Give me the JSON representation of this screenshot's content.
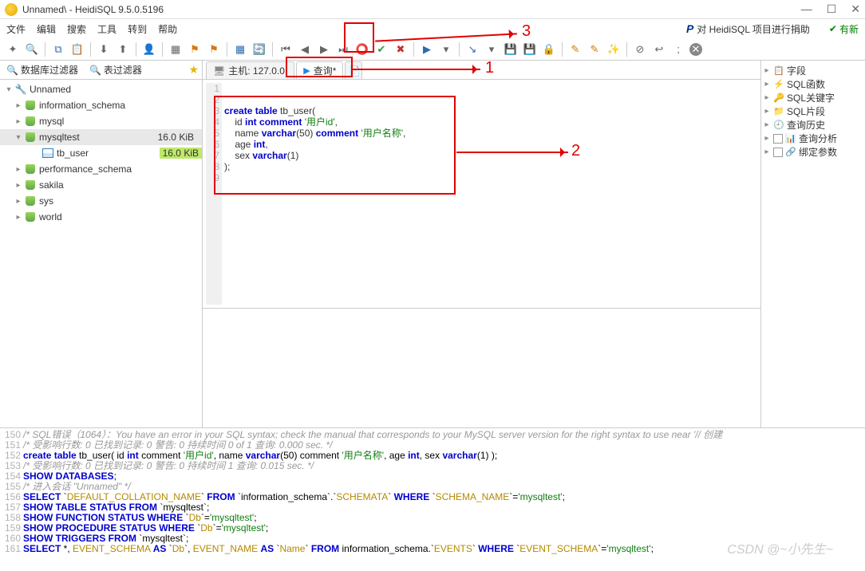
{
  "window": {
    "title": "Unnamed\\ - HeidiSQL 9.5.0.5196"
  },
  "menu": {
    "file": "文件",
    "edit": "编辑",
    "search": "搜索",
    "tools": "工具",
    "goto": "转到",
    "help": "帮助",
    "donate": "对 HeidiSQL 项目进行捐助",
    "update": "有新"
  },
  "filters": {
    "db": "数据库过滤器",
    "table": "表过滤器"
  },
  "tree": {
    "conn": "Unnamed",
    "items": [
      {
        "label": "information_schema"
      },
      {
        "label": "mysql"
      },
      {
        "label": "mysqltest",
        "size": "16.0 KiB",
        "expanded": true,
        "sel": true,
        "children": [
          {
            "label": "tb_user",
            "size": "16.0 KiB",
            "highlight": true
          }
        ]
      },
      {
        "label": "performance_schema"
      },
      {
        "label": "sakila"
      },
      {
        "label": "sys"
      },
      {
        "label": "world"
      }
    ]
  },
  "tabs": {
    "host": "主机: 127.0.0.",
    "query": "查询*"
  },
  "code": {
    "lines": [
      "",
      "",
      "create table tb_user(",
      "    id int comment '用户id',",
      "    name varchar(50) comment '用户名称',",
      "    age int,",
      "    sex varchar(1)",
      ");",
      ""
    ]
  },
  "right": {
    "items": [
      {
        "label": "字段",
        "icon": "📋"
      },
      {
        "label": "SQL函数",
        "icon": "⚡"
      },
      {
        "label": "SQL关键字",
        "icon": "🔑"
      },
      {
        "label": "SQL片段",
        "icon": "📁"
      },
      {
        "label": "查询历史",
        "icon": "🕘"
      },
      {
        "label": "查询分析",
        "icon": "📊",
        "cb": true
      },
      {
        "label": "绑定参数",
        "icon": "🔗",
        "cb": true
      }
    ]
  },
  "log": {
    "lines": [
      {
        "n": "150",
        "html": "<span class='cm'>/* SQL错误（1064）：You have an error in your SQL syntax; check the manual that corresponds to your MySQL server version for the right syntax to use near '// 创建</span>"
      },
      {
        "n": "151",
        "html": "<span class='cm'>/* 受影响行数: 0  已找到记录: 0  警告: 0  持续时间 0 of 1 查询: 0.000 sec. */</span>"
      },
      {
        "n": "152",
        "html": "<span class='kw'>create table</span> tb_user(      id <span class='kw'>int</span> comment <span class='str'>'用户id'</span>,      name <span class='kw'>varchar</span>(50) comment <span class='str'>'用户名称'</span>,      age <span class='kw'>int</span>,      sex <span class='kw'>varchar</span>(1)  );"
      },
      {
        "n": "153",
        "html": "<span class='cm'>/* 受影响行数: 0  已找到记录: 0  警告: 0  持续时间 1 查询: 0.015 sec. */</span>"
      },
      {
        "n": "154",
        "html": "<span class='kw'>SHOW DATABASES</span>;"
      },
      {
        "n": "155",
        "html": "<span class='cm'>/* 进入会话 \"Unnamed\" */</span>"
      },
      {
        "n": "156",
        "html": "<span class='kw'>SELECT</span> `<span class='fn'>DEFAULT_COLLATION_NAME</span>` <span class='kw'>FROM</span> `information_schema`.`<span class='fn'>SCHEMATA</span>` <span class='kw'>WHERE</span> `<span class='fn'>SCHEMA_NAME</span>`=<span class='str'>'mysqltest'</span>;"
      },
      {
        "n": "157",
        "html": "<span class='kw'>SHOW TABLE STATUS FROM</span> `mysqltest`;"
      },
      {
        "n": "158",
        "html": "<span class='kw'>SHOW FUNCTION STATUS WHERE</span> `<span class='fn'>Db</span>`=<span class='str'>'mysqltest'</span>;"
      },
      {
        "n": "159",
        "html": "<span class='kw'>SHOW PROCEDURE STATUS WHERE</span> `<span class='fn'>Db</span>`=<span class='str'>'mysqltest'</span>;"
      },
      {
        "n": "160",
        "html": "<span class='kw'>SHOW TRIGGERS FROM</span> `mysqltest`;"
      },
      {
        "n": "161",
        "html": "<span class='kw'>SELECT</span> *, <span class='fn'>EVENT_SCHEMA</span> <span class='kw'>AS</span> `<span class='fn'>Db</span>`, <span class='fn'>EVENT_NAME</span> <span class='kw'>AS</span> `<span class='fn'>Name</span>` <span class='kw'>FROM</span> information_schema.`<span class='fn'>EVENTS</span>` <span class='kw'>WHERE</span> `<span class='fn'>EVENT_SCHEMA</span>`=<span class='str'>'mysqltest'</span>;"
      }
    ]
  },
  "annotations": {
    "n1": "1",
    "n2": "2",
    "n3": "3"
  },
  "watermark": "CSDN @~小先生~"
}
